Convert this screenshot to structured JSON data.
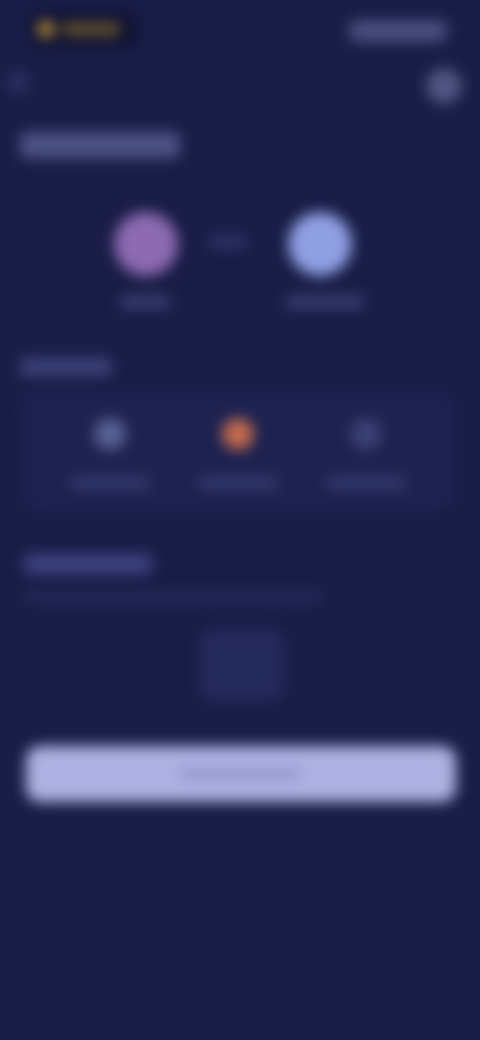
{
  "header": {
    "logo": {
      "icon": "brand-logo"
    },
    "right_control": {
      "icon": "account-pill"
    }
  },
  "nav": {
    "back": {
      "icon": "back-arrow-icon"
    },
    "settings": {
      "icon": "settings-icon"
    }
  },
  "swap": {
    "from_token": {
      "icon": "token-icon",
      "color": "#8d6ab2"
    },
    "to_token": {
      "icon": "token-icon",
      "color": "#8f9fe2"
    },
    "direction": {
      "icon": "swap-arrow-icon"
    }
  },
  "options": {
    "items": [
      {
        "icon": "option-icon",
        "color": "#5a6294"
      },
      {
        "icon": "option-icon",
        "color": "#c46a4e"
      },
      {
        "icon": "option-icon",
        "color": "#3b4174"
      }
    ]
  },
  "cta": {
    "color": "#aeb2e2"
  }
}
